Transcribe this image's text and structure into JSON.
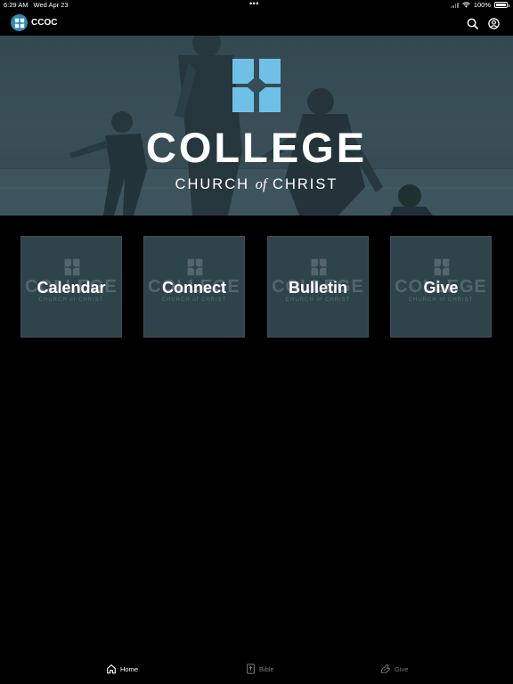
{
  "status_bar": {
    "time": "6:29 AM",
    "date": "Wed Apr 23",
    "battery": "100%",
    "battery_level": 1.0
  },
  "app_bar": {
    "title": "CCOC",
    "logo_icon": "church-cross-logo",
    "actions": [
      "search-icon",
      "account-icon"
    ]
  },
  "hero": {
    "title": "COLLEGE",
    "subtitle_before": "CHURCH ",
    "subtitle_em": "of",
    "subtitle_after": " CHRIST"
  },
  "tiles": [
    {
      "label": "Calendar",
      "watermark": "COLLEGE",
      "watermark_sub": "CHURCH of CHRIST"
    },
    {
      "label": "Connect",
      "watermark": "COLLEGE",
      "watermark_sub": "CHURCH of CHRIST"
    },
    {
      "label": "Bulletin",
      "watermark": "COLLEGE",
      "watermark_sub": "CHURCH of CHRIST"
    },
    {
      "label": "Give",
      "watermark": "COLLEGE",
      "watermark_sub": "CHURCH of CHRIST"
    }
  ],
  "tab_bar": {
    "items": [
      {
        "label": "Home",
        "icon": "home-icon",
        "active": true
      },
      {
        "label": "Bible",
        "icon": "bible-icon",
        "active": false
      },
      {
        "label": "Give",
        "icon": "give-icon",
        "active": false
      }
    ]
  },
  "colors": {
    "accent": "#6fc0e6",
    "tile": "#2f434b",
    "background": "#000000"
  }
}
